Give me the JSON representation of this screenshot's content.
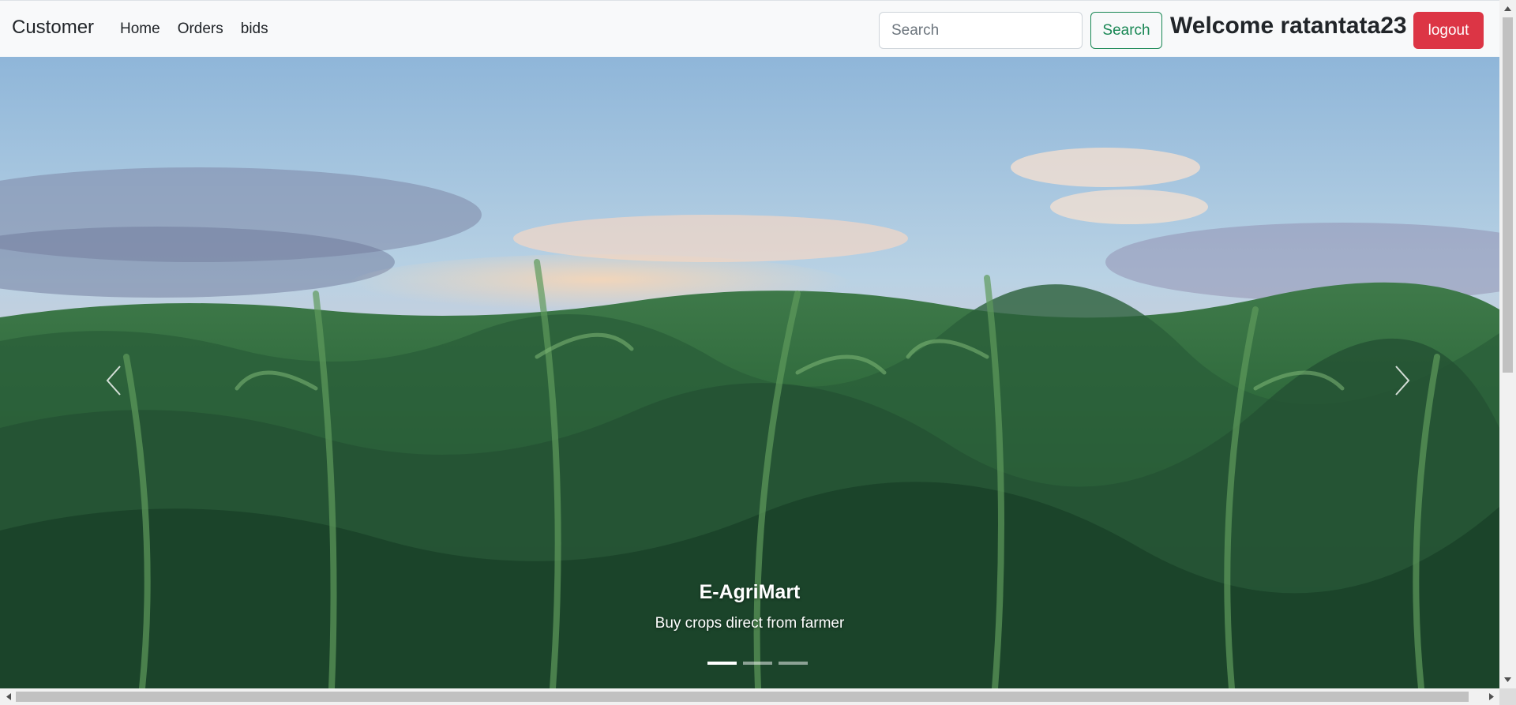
{
  "navbar": {
    "brand": "Customer",
    "links": [
      "Home",
      "Orders",
      "bids"
    ],
    "search_placeholder": "Search",
    "search_button": "Search",
    "welcome": "Welcome ratantata23",
    "logout": "logout"
  },
  "carousel": {
    "caption_title": "E-AgriMart",
    "caption_text": "Buy crops direct from farmer",
    "slide_count": 3,
    "active_index": 0,
    "image": "corn field at sunset"
  },
  "colors": {
    "navbar_bg": "#f8f9fa",
    "success": "#198754",
    "danger": "#dc3545"
  }
}
